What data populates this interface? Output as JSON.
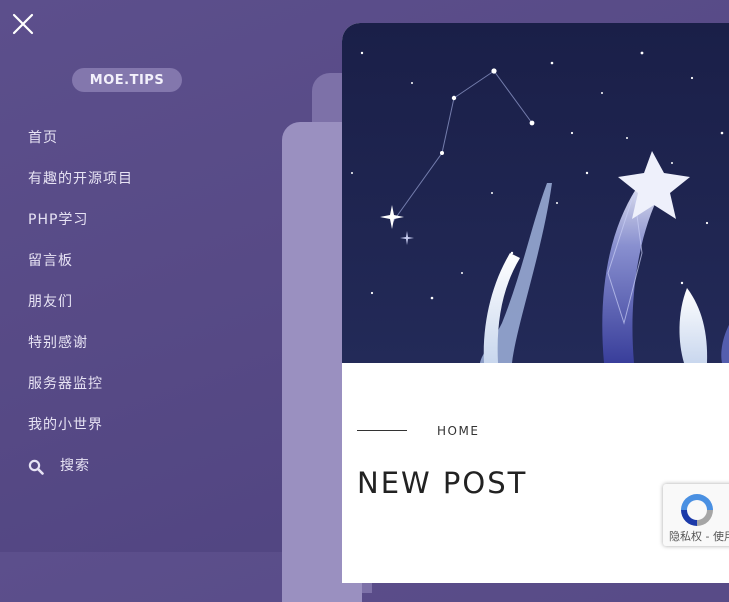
{
  "brand": {
    "label": "MOE.TIPS"
  },
  "nav": {
    "items": [
      {
        "label": "首页"
      },
      {
        "label": "有趣的开源项目"
      },
      {
        "label": "PHP学习"
      },
      {
        "label": "留言板"
      },
      {
        "label": "朋友们"
      },
      {
        "label": "特别感谢"
      },
      {
        "label": "服务器监控"
      },
      {
        "label": "我的小世界"
      }
    ],
    "search_label": "搜索"
  },
  "post": {
    "breadcrumb": "HOME",
    "title": "NEW POST"
  },
  "recaptcha": {
    "text": "隐私权 - 使用条款"
  },
  "icons": {
    "close": "close-icon",
    "search": "search-icon",
    "recaptcha": "recaptcha-logo-icon"
  },
  "colors": {
    "sidebar_bg": "#574a86",
    "brand_pill": "#8377ad",
    "card_bg": "#ffffff",
    "night_sky": "#1e2451"
  }
}
